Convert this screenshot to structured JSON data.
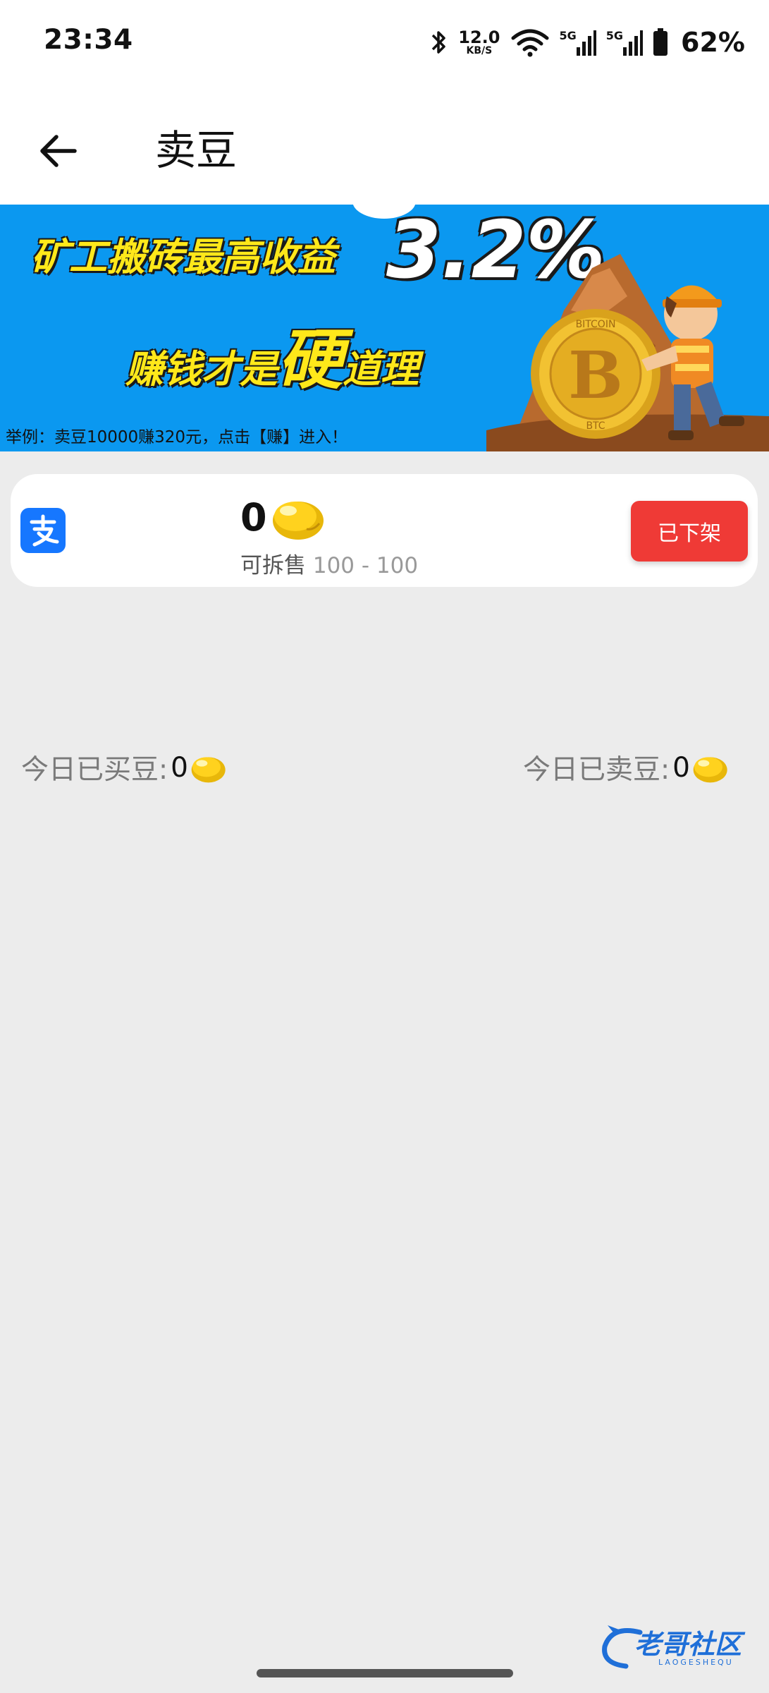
{
  "status_bar": {
    "time": "23:34",
    "network_speed_value": "12.0",
    "network_speed_unit": "KB/S",
    "signal_label_1": "5G",
    "signal_label_2": "5G",
    "battery": "62%"
  },
  "header": {
    "title": "卖豆",
    "back_icon": "arrow-left-icon"
  },
  "banner": {
    "headline": "矿工搬砖最高收益",
    "rate": "3.2%",
    "slogan_start": "赚钱才是",
    "slogan_emphasis": "硬",
    "slogan_end": "道理",
    "note": "举例：卖豆10000赚320元，点击【赚】进入！",
    "coin_label_top": "BITCOIN",
    "coin_label_bottom": "BTC",
    "colors": {
      "background": "#0b98f0",
      "headline": "#ffe81a"
    }
  },
  "balance_card": {
    "payment_icon": "alipay-icon",
    "amount": "0",
    "sellable_label": "可拆售",
    "sellable_range": "100 - 100",
    "status_button_label": "已下架",
    "button_color": "#ef3a36"
  },
  "stats": {
    "bought_label": "今日已买豆:",
    "bought_value": "0",
    "sold_label": "今日已卖豆:",
    "sold_value": "0",
    "unit_icon": "bean-icon"
  },
  "watermark": {
    "text": "老哥社区",
    "subtext": "LAOGESHEQU"
  }
}
